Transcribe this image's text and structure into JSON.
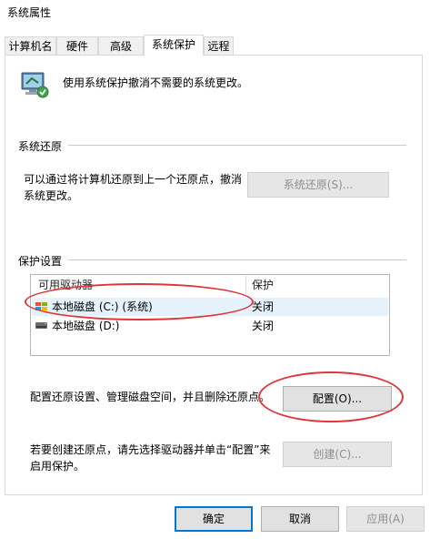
{
  "window": {
    "title": "系统属性"
  },
  "tabs": [
    {
      "label": "计算机名"
    },
    {
      "label": "硬件"
    },
    {
      "label": "高级"
    },
    {
      "label": "系统保护"
    },
    {
      "label": "远程"
    }
  ],
  "intro": {
    "text": "使用系统保护撤消不需要的系统更改。"
  },
  "restore": {
    "section_label": "系统还原",
    "description": "可以通过将计算机还原到上一个还原点，撤消系统更改。",
    "button_label": "系统还原(S)..."
  },
  "protection": {
    "section_label": "保护设置",
    "columns": [
      "可用驱动器",
      "保护"
    ],
    "drives": [
      {
        "name": "本地磁盘 (C:) (系统)",
        "protection": "关闭",
        "icon": "system-drive-icon"
      },
      {
        "name": "本地磁盘 (D:)",
        "protection": "关闭",
        "icon": "drive-icon"
      }
    ],
    "configure_text": "配置还原设置、管理磁盘空间，并且删除还原点。",
    "configure_button": "配置(O)...",
    "create_text": "若要创建还原点，请先选择驱动器并单击“配置”来启用保护。",
    "create_button": "创建(C)..."
  },
  "footer": {
    "ok": "确定",
    "cancel": "取消",
    "apply": "应用(A)"
  },
  "colors": {
    "accent": "#0078d7",
    "annotation": "#e0353a",
    "selection": "#e5f1fb"
  }
}
